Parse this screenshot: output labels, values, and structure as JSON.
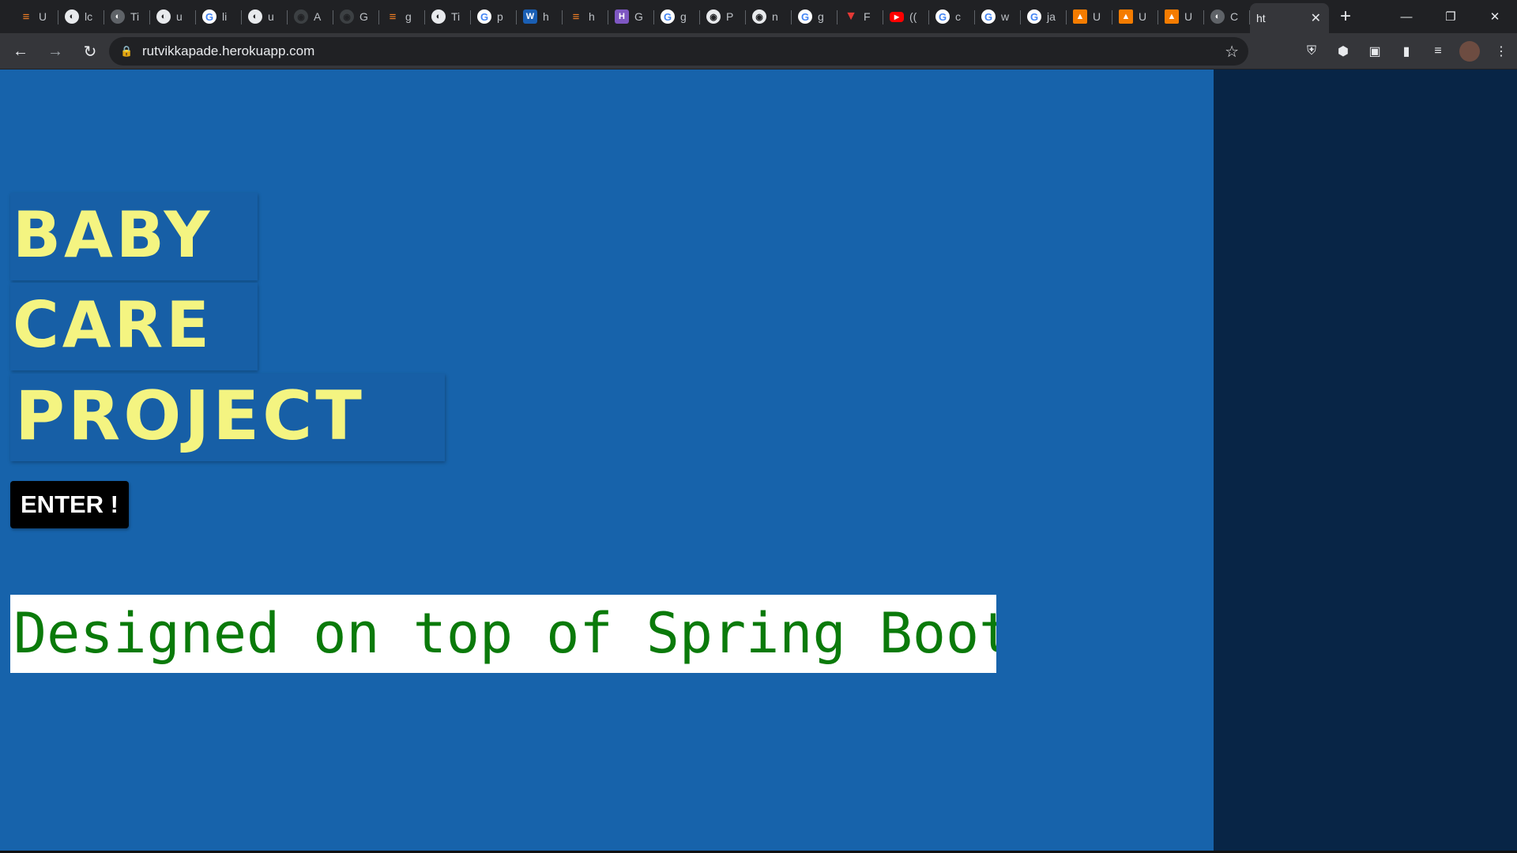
{
  "browser": {
    "tabs": [
      {
        "icon": "stackoverflow-icon",
        "glyph": "≡",
        "cls": "so",
        "label": "U"
      },
      {
        "icon": "globe-icon",
        "glyph": "◐",
        "cls": "globe",
        "label": "lc"
      },
      {
        "icon": "globe-icon",
        "glyph": "◐",
        "cls": "grey",
        "label": "Ti"
      },
      {
        "icon": "globe-icon",
        "glyph": "◐",
        "cls": "globe",
        "label": "u"
      },
      {
        "icon": "google-icon",
        "glyph": "G",
        "cls": "g",
        "label": "li"
      },
      {
        "icon": "globe-icon",
        "glyph": "◐",
        "cls": "globe",
        "label": "u"
      },
      {
        "icon": "github-icon",
        "glyph": "◉",
        "cls": "ghdim",
        "label": "A"
      },
      {
        "icon": "github-icon",
        "glyph": "◉",
        "cls": "ghdim",
        "label": "G"
      },
      {
        "icon": "stackoverflow-icon",
        "glyph": "≡",
        "cls": "so",
        "label": "g"
      },
      {
        "icon": "globe-icon",
        "glyph": "◐",
        "cls": "globe",
        "label": "Ti"
      },
      {
        "icon": "google-icon",
        "glyph": "G",
        "cls": "g",
        "label": "p"
      },
      {
        "icon": "word-icon",
        "glyph": "W",
        "cls": "w",
        "label": "h"
      },
      {
        "icon": "stackoverflow-icon",
        "glyph": "≡",
        "cls": "so",
        "label": "h"
      },
      {
        "icon": "heroku-icon",
        "glyph": "H",
        "cls": "h",
        "label": "G"
      },
      {
        "icon": "google-icon",
        "glyph": "G",
        "cls": "g",
        "label": "g"
      },
      {
        "icon": "github-icon",
        "glyph": "◉",
        "cls": "gh",
        "label": "P"
      },
      {
        "icon": "github-icon",
        "glyph": "◉",
        "cls": "gh",
        "label": "n"
      },
      {
        "icon": "google-icon",
        "glyph": "G",
        "cls": "g",
        "label": "g"
      },
      {
        "icon": "vivaldi-icon",
        "glyph": "▼",
        "cls": "v",
        "label": "F"
      },
      {
        "icon": "youtube-icon",
        "glyph": "▶",
        "cls": "yt",
        "label": "(("
      },
      {
        "icon": "google-icon",
        "glyph": "G",
        "cls": "g",
        "label": "c"
      },
      {
        "icon": "google-icon",
        "glyph": "G",
        "cls": "g",
        "label": "w"
      },
      {
        "icon": "google-icon",
        "glyph": "G",
        "cls": "g",
        "label": "ja"
      },
      {
        "icon": "udemy-icon",
        "glyph": "▲",
        "cls": "ud",
        "label": "U"
      },
      {
        "icon": "udemy-icon",
        "glyph": "▲",
        "cls": "ud",
        "label": "U"
      },
      {
        "icon": "udemy-icon",
        "glyph": "▲",
        "cls": "ud",
        "label": "U"
      },
      {
        "icon": "globe-icon",
        "glyph": "◐",
        "cls": "grey",
        "label": "C"
      }
    ],
    "active_tab": {
      "label": "ht",
      "close": "✕"
    },
    "new_tab": "+",
    "window": {
      "minimize": "—",
      "restore": "❐",
      "close": "✕"
    },
    "nav": {
      "back": "←",
      "forward": "→",
      "reload": "↻"
    },
    "omnibox": {
      "lock": "🔒",
      "url": "rutvikkapade.herokuapp.com",
      "star": "☆"
    },
    "extensions": [
      {
        "name": "shield-extension-icon",
        "glyph": "⛨"
      },
      {
        "name": "cube-extension-icon",
        "glyph": "⬢"
      },
      {
        "name": "window-extension-icon",
        "glyph": "▣"
      },
      {
        "name": "bookmark-extension-icon",
        "glyph": "▮"
      },
      {
        "name": "media-control-icon",
        "glyph": "≡"
      }
    ],
    "menu": "⋮"
  },
  "page": {
    "title_lines": [
      "BABY",
      "CARE",
      "PROJECT"
    ],
    "enter_button": "ENTER !",
    "banner": "Designed on top of Spring Boot"
  },
  "colors": {
    "page_bg": "#1763ab",
    "title_text": "#f4f481",
    "banner_text": "#0a7a0a",
    "side_pane": "#082546"
  }
}
